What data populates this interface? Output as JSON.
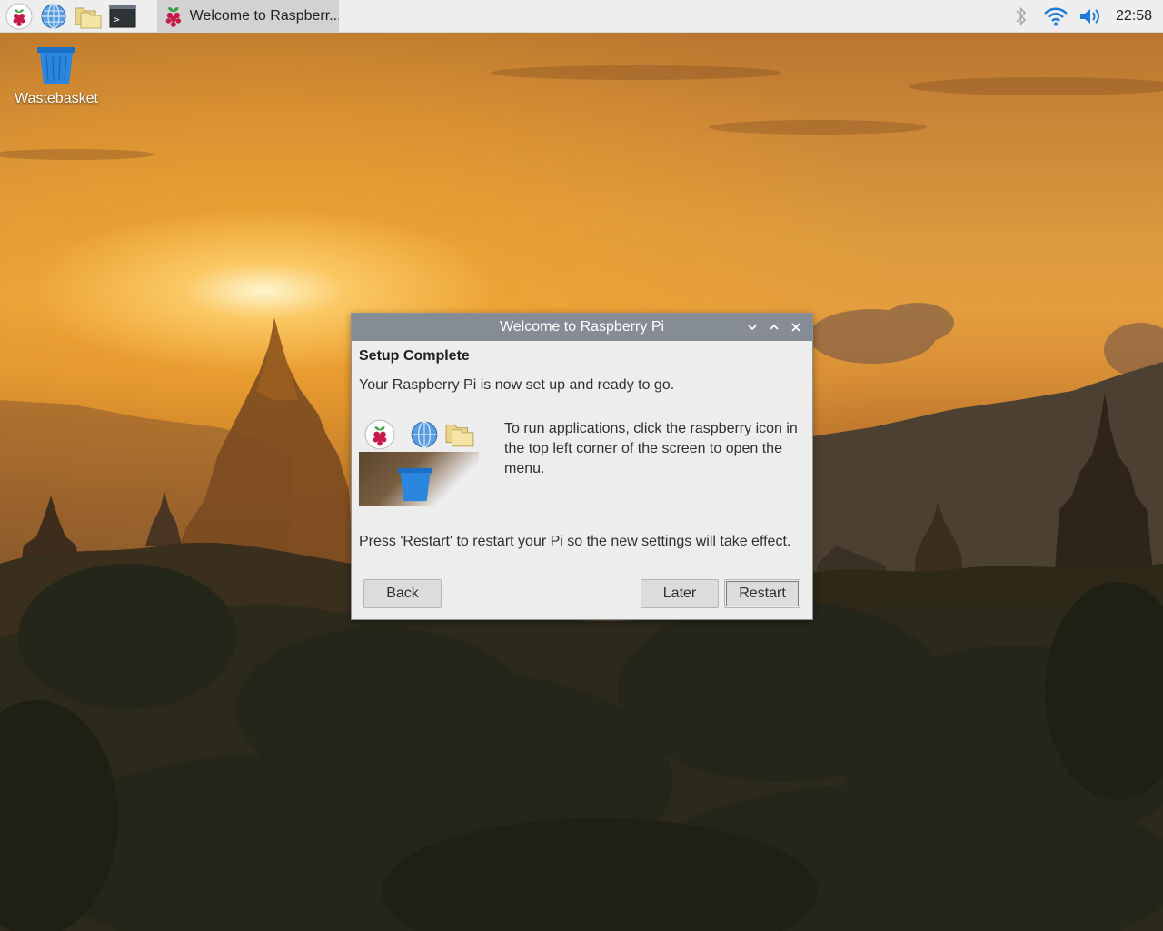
{
  "taskbar": {
    "launchers": [
      {
        "icon": "raspberry-icon"
      },
      {
        "icon": "globe-icon"
      },
      {
        "icon": "folder-icon"
      },
      {
        "icon": "terminal-icon",
        "glyph": ">_"
      }
    ],
    "task": {
      "label": "Welcome to Raspberr...",
      "icon": "raspberry-icon"
    },
    "tray": {
      "bluetooth_icon": "bluetooth-icon",
      "wifi_icon": "wifi-icon",
      "volume_icon": "volume-icon",
      "clock": "22:58"
    }
  },
  "desktop": {
    "icons": [
      {
        "label": "Wastebasket",
        "icon": "wastebasket-icon"
      }
    ]
  },
  "dialog": {
    "title": "Welcome to Raspberry Pi",
    "heading": "Setup Complete",
    "text1": "Your Raspberry Pi is now set up and ready to go.",
    "text2": "To run applications, click the raspberry icon in the top left corner of the screen to open the menu.",
    "text3": "Press 'Restart' to restart your Pi so the new settings will take effect.",
    "buttons": {
      "back": "Back",
      "later": "Later",
      "restart": "Restart"
    }
  },
  "colors": {
    "taskbar_bg": "#eeeeee",
    "titlebar_bg": "#868c95",
    "dialog_bg": "#ededed",
    "accent_blue": "#1f7ad6",
    "raspberry_red": "#c51a4a"
  }
}
